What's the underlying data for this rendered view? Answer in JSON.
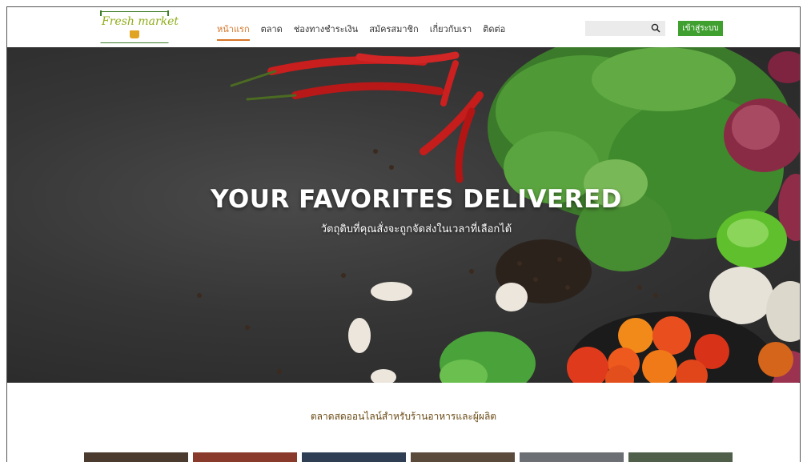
{
  "header": {
    "logo_text": "Fresh market",
    "nav": [
      {
        "label": "หน้าแรก",
        "active": true
      },
      {
        "label": "ตลาด",
        "active": false
      },
      {
        "label": "ช่องทางชำระเงิน",
        "active": false
      },
      {
        "label": "สมัครสมาชิก",
        "active": false
      },
      {
        "label": "เกี่ยวกับเรา",
        "active": false
      },
      {
        "label": "ติดต่อ",
        "active": false
      }
    ],
    "search_placeholder": "",
    "search_icon": "search-icon",
    "login_label": "เข้าสู่ระบบ"
  },
  "hero": {
    "title": "YOUR FAVORITES DELIVERED",
    "subtitle": "วัตถุดิบที่คุณสั่งจะถูกจัดส่งในเวลาที่เลือกได้"
  },
  "section": {
    "title": "ตลาดสดออนไลน์สำหรับร้านอาหารและผู้ผลิต"
  },
  "colors": {
    "accent": "#d6762a",
    "button": "#3f9f2f",
    "logo": "#8fae1b",
    "section_title": "#6b4b16"
  }
}
